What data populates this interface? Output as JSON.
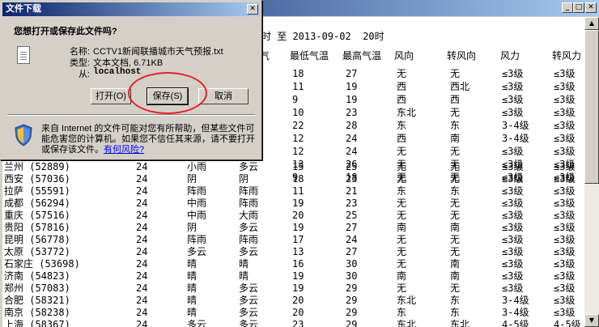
{
  "dialog": {
    "title": "文件下载",
    "close_glyph": "✕",
    "question": "您想打开或保存此文件吗?",
    "name_label": "名称:",
    "name_value": "CCTV1新闻联播城市天气预报.txt",
    "type_label": "类型:",
    "type_value": "文本文档, 6.71KB",
    "from_label": "从:",
    "from_value": "localhost",
    "open_button": "打开(O)",
    "save_button": "保存(S)",
    "cancel_button": "取消",
    "warning_text": "来自 Internet 的文件可能对您有所帮助，但某些文件可能危害您的计算机。如果您不信任其来源，请不要打开或保存该文件。",
    "risk_link": "有何风险?"
  },
  "window_controls": {
    "minimize": "_",
    "maximize": "□",
    "close": "✕"
  },
  "weather": {
    "time_range": "时 至 2013-09-02  20时",
    "headers": [
      "气",
      "最低气温",
      "最高气温",
      "风向",
      "转风向",
      "风力",
      "转风力"
    ],
    "partial_rows": [
      [
        "18",
        "27",
        "无",
        "无",
        "≤3级",
        "≤3级"
      ],
      [
        "11",
        "19",
        "西",
        "西北",
        "≤3级",
        "≤3级"
      ],
      [
        "9",
        "19",
        "西",
        "西",
        "≤3级",
        "≤3级"
      ],
      [
        "10",
        "23",
        "东北",
        "无",
        "≤3级",
        "≤3级"
      ],
      [
        "22",
        "28",
        "东",
        "东",
        "3-4级",
        "≤3级"
      ],
      [
        "12",
        "24",
        "西",
        "南",
        "3-4级",
        "≤3级"
      ],
      [
        "12",
        "24",
        "无",
        "无",
        "≤3级",
        "≤3级"
      ],
      [
        "13",
        "26",
        "无",
        "无",
        "≤3级",
        "≤3级"
      ],
      [
        "9",
        "18",
        "无",
        "无",
        "≤3级",
        "≤3级"
      ]
    ],
    "rows": [
      {
        "city": "兰州 (52889)",
        "h": "24",
        "w1": "小雨",
        "w2": "多云",
        "min": "15",
        "max": "25",
        "d1": "无",
        "d2": "无",
        "f1": "≤3级",
        "f2": "≤3级"
      },
      {
        "city": "西安 (57036)",
        "h": "24",
        "w1": "阴",
        "w2": "阴",
        "min": "18",
        "max": "23",
        "d1": "无",
        "d2": "无",
        "f1": "≤3级",
        "f2": "≤3级"
      },
      {
        "city": "拉萨 (55591)",
        "h": "24",
        "w1": "阵雨",
        "w2": "阵雨",
        "min": "11",
        "max": "21",
        "d1": "东",
        "d2": "东",
        "f1": "≤3级",
        "f2": "≤3级"
      },
      {
        "city": "成都 (56294)",
        "h": "24",
        "w1": "中雨",
        "w2": "阵雨",
        "min": "19",
        "max": "23",
        "d1": "无",
        "d2": "无",
        "f1": "≤3级",
        "f2": "≤3级"
      },
      {
        "city": "重庆 (57516)",
        "h": "24",
        "w1": "中雨",
        "w2": "大雨",
        "min": "20",
        "max": "25",
        "d1": "无",
        "d2": "无",
        "f1": "≤3级",
        "f2": "≤3级"
      },
      {
        "city": "贵阳 (57816)",
        "h": "24",
        "w1": "阴",
        "w2": "多云",
        "min": "19",
        "max": "27",
        "d1": "南",
        "d2": "南",
        "f1": "≤3级",
        "f2": "≤3级"
      },
      {
        "city": "昆明 (56778)",
        "h": "24",
        "w1": "阵雨",
        "w2": "阵雨",
        "min": "17",
        "max": "24",
        "d1": "无",
        "d2": "无",
        "f1": "≤3级",
        "f2": "≤3级"
      },
      {
        "city": "太原 (53772)",
        "h": "24",
        "w1": "多云",
        "w2": "多云",
        "min": "13",
        "max": "27",
        "d1": "无",
        "d2": "无",
        "f1": "≤3级",
        "f2": "≤3级"
      },
      {
        "city": "石家庄 (53698)",
        "h": "24",
        "w1": "晴",
        "w2": "晴",
        "min": "16",
        "max": "30",
        "d1": "无",
        "d2": "南",
        "f1": "≤3级",
        "f2": "≤3级"
      },
      {
        "city": "济南 (54823)",
        "h": "24",
        "w1": "晴",
        "w2": "晴",
        "min": "19",
        "max": "30",
        "d1": "南",
        "d2": "南",
        "f1": "≤3级",
        "f2": "≤3级"
      },
      {
        "city": "郑州 (57083)",
        "h": "24",
        "w1": "晴",
        "w2": "多云",
        "min": "19",
        "max": "29",
        "d1": "无",
        "d2": "无",
        "f1": "≤3级",
        "f2": "≤3级"
      },
      {
        "city": "合肥 (58321)",
        "h": "24",
        "w1": "晴",
        "w2": "多云",
        "min": "20",
        "max": "29",
        "d1": "东北",
        "d2": "东",
        "f1": "3-4级",
        "f2": "≤3级"
      },
      {
        "city": "南京 (58238)",
        "h": "24",
        "w1": "晴",
        "w2": "多云",
        "min": "20",
        "max": "29",
        "d1": "东",
        "d2": "东",
        "f1": "3-4级",
        "f2": "≤3级"
      },
      {
        "city": "上海 (58367)",
        "h": "24",
        "w1": "多云",
        "w2": "多云",
        "min": "23",
        "max": "29",
        "d1": "东北",
        "d2": "东北",
        "f1": "4-5级",
        "f2": "4-5级"
      }
    ]
  },
  "scrollbar": {
    "up_arrow": "▲",
    "down_arrow": "▼"
  },
  "colors": {
    "title_bar_start": "#0a246a",
    "title_bar_end": "#a6caf0",
    "highlight_circle": "#e3232c",
    "link": "#0000ff"
  }
}
